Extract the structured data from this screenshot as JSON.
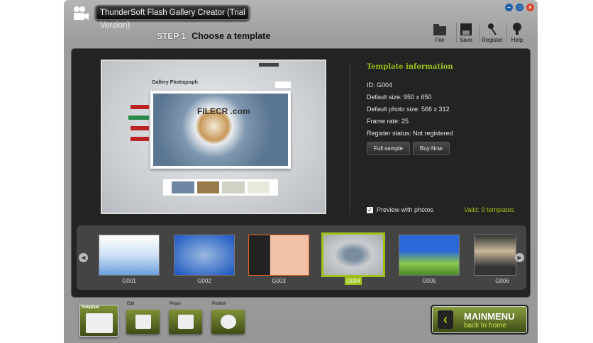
{
  "window": {
    "title": "ThunderSoft Flash Gallery Creator (Trial Version)",
    "controls": [
      "minimize",
      "maximize",
      "close"
    ]
  },
  "step": {
    "number": "STEP 1",
    "title": "Choose a template"
  },
  "toolbar": [
    {
      "label": "File",
      "icon": "folder-icon"
    },
    {
      "label": "Save",
      "icon": "save-icon"
    },
    {
      "label": "Register",
      "icon": "key-icon"
    },
    {
      "label": "Help",
      "icon": "bulb-icon"
    }
  ],
  "preview": {
    "gallery_title": "Gallery Photograph",
    "watermark": "FILECR .com"
  },
  "info": {
    "heading": "Template information",
    "id": "ID: G004",
    "default_size": "Default size: 950 x 650",
    "photo_size": "Default photo size: 566 x 312",
    "frame_rate": "Frame rate: 25",
    "register_status": "Register status: Not registered",
    "full_sample": "Full sample",
    "buy_now": "Buy Now",
    "preview_with_photos": "Preview with photos",
    "preview_checked": true,
    "valid": "Valid: 9 templates"
  },
  "templates": [
    {
      "id": "G001"
    },
    {
      "id": "G002"
    },
    {
      "id": "G003"
    },
    {
      "id": "G004",
      "selected": true
    },
    {
      "id": "G005"
    },
    {
      "id": "G006"
    }
  ],
  "tabs": [
    {
      "label": "Template",
      "active": true
    },
    {
      "label": "Edit"
    },
    {
      "label": "Photo"
    },
    {
      "label": "Publish"
    }
  ],
  "mainmenu": {
    "title": "MAINMENU",
    "subtitle": "back to home"
  },
  "colors": {
    "accent": "#9cc21a",
    "panel": "#232323"
  }
}
